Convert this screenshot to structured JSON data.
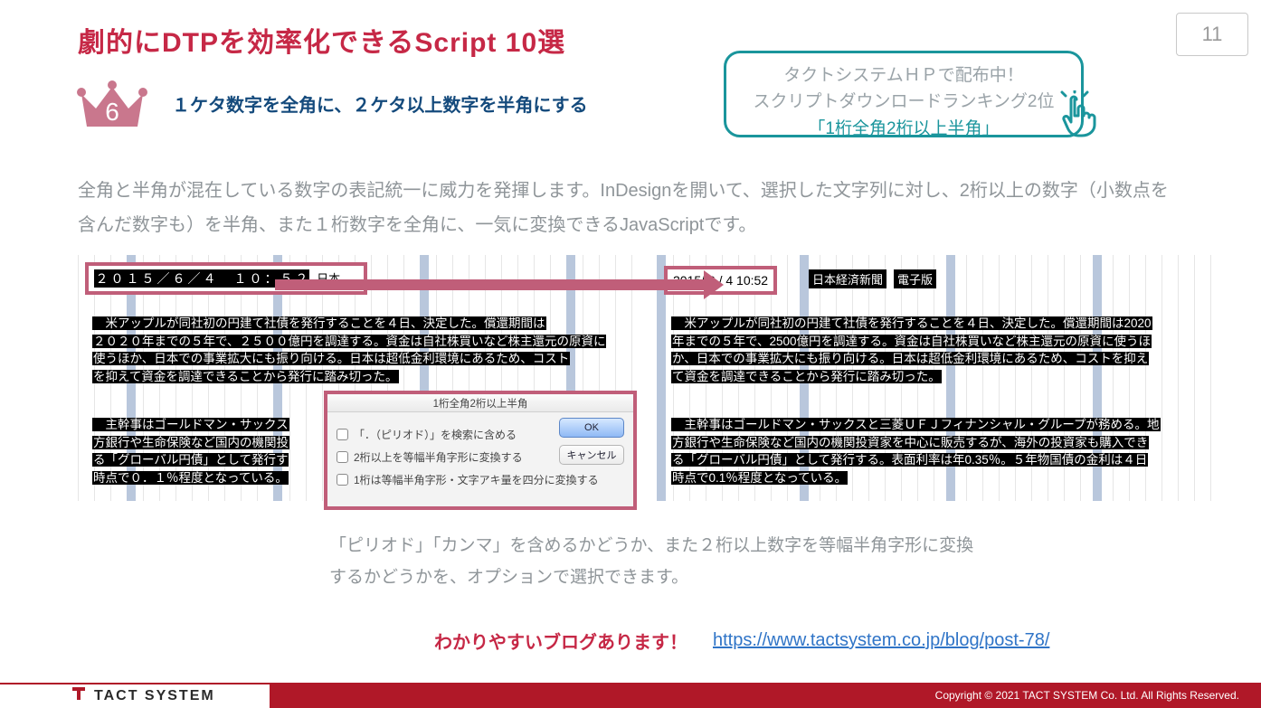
{
  "page": {
    "title": "劇的にDTPを効率化できるScript 10選",
    "number": "11"
  },
  "callout": {
    "line1": "タクトシステムＨＰで配布中！",
    "line2": "スクリプトダウンロードランキング2位",
    "script_name": "「1桁全角2桁以上半角」"
  },
  "ranking": {
    "num": "6",
    "subtitle": "１ケタ数字を全角に、２ケタ以上数字を半角にする"
  },
  "description": "全角と半角が混在している数字の表記統一に威力を発揮します。InDesignを開いて、選択した文字列に対し、2桁以上の数字（小数点を含んだ数字も）を半角、また１桁数字を全角に、一気に変換できるJavaScriptです。",
  "before": {
    "date_cells": [
      "２",
      "０",
      "１",
      "５",
      "／",
      "６",
      "／",
      "４",
      " ",
      "１",
      "０",
      "：",
      "５",
      "２"
    ],
    "date_trail": "日本",
    "para1": [
      "　米アップルが同社初の円建て社債を発行することを４日、決定した。償還期間は",
      "２０２０年までの５年で、２５００億円を調達する。資金は自社株買いなど株主還元の原資に",
      "使うほか、日本での事業拡大にも振り向ける。日本は超低金利環境にあるため、コスト",
      "を抑えて資金を調達できることから発行に踏み切った。"
    ],
    "para2": [
      "　主幹事はゴールドマン・サックス",
      "方銀行や生命保険など国内の機関投",
      "る「グローバル円債」として発行す",
      "時点で０．１％程度となっている。"
    ]
  },
  "after": {
    "date": "2015/ 6 / 4  10:52",
    "label1": "日本経済新聞",
    "label2": "電子版",
    "para1": [
      "　米アップルが同社初の円建て社債を発行することを４日、決定した。償還期間は2020",
      "年までの５年で、2500億円を調達する。資金は自社株買いなど株主還元の原資に使うほ",
      "か、日本での事業拡大にも振り向ける。日本は超低金利環境にあるため、コストを抑え",
      "て資金を調達できることから発行に踏み切った。"
    ],
    "para2": [
      "　主幹事はゴールドマン・サックスと三菱ＵＦＪフィナンシャル・グループが務める。地",
      "方銀行や生命保険など国内の機関投資家を中心に販売するが、海外の投資家も購入でき",
      "る「グローバル円債」として発行する。表面利率は年0.35％。５年物国債の金利は４日",
      "時点で0.1％程度となっている。"
    ]
  },
  "dialog": {
    "title": "1桁全角2桁以上半角",
    "opt1": "「．（ピリオド）」を検索に含める",
    "opt2": "2桁以上を等幅半角字形に変換する",
    "opt3": "1桁は等幅半角字形・文字アキ量を四分に変換する",
    "ok": "OK",
    "cancel": "キャンセル"
  },
  "caption": "「ピリオド」「カンマ」を含めるかどうか、また２桁以上数字を等幅半角字形に変換するかどうかを、オプションで選択できます。",
  "blog": {
    "lead": "わかりやすいブログあります！",
    "url": "https://www.tactsystem.co.jp/blog/post-78/"
  },
  "footer": {
    "brand": "TACT SYSTEM",
    "copyright": "Copyright © 2021 TACT SYSTEM Co. Ltd. All Rights Reserved."
  }
}
